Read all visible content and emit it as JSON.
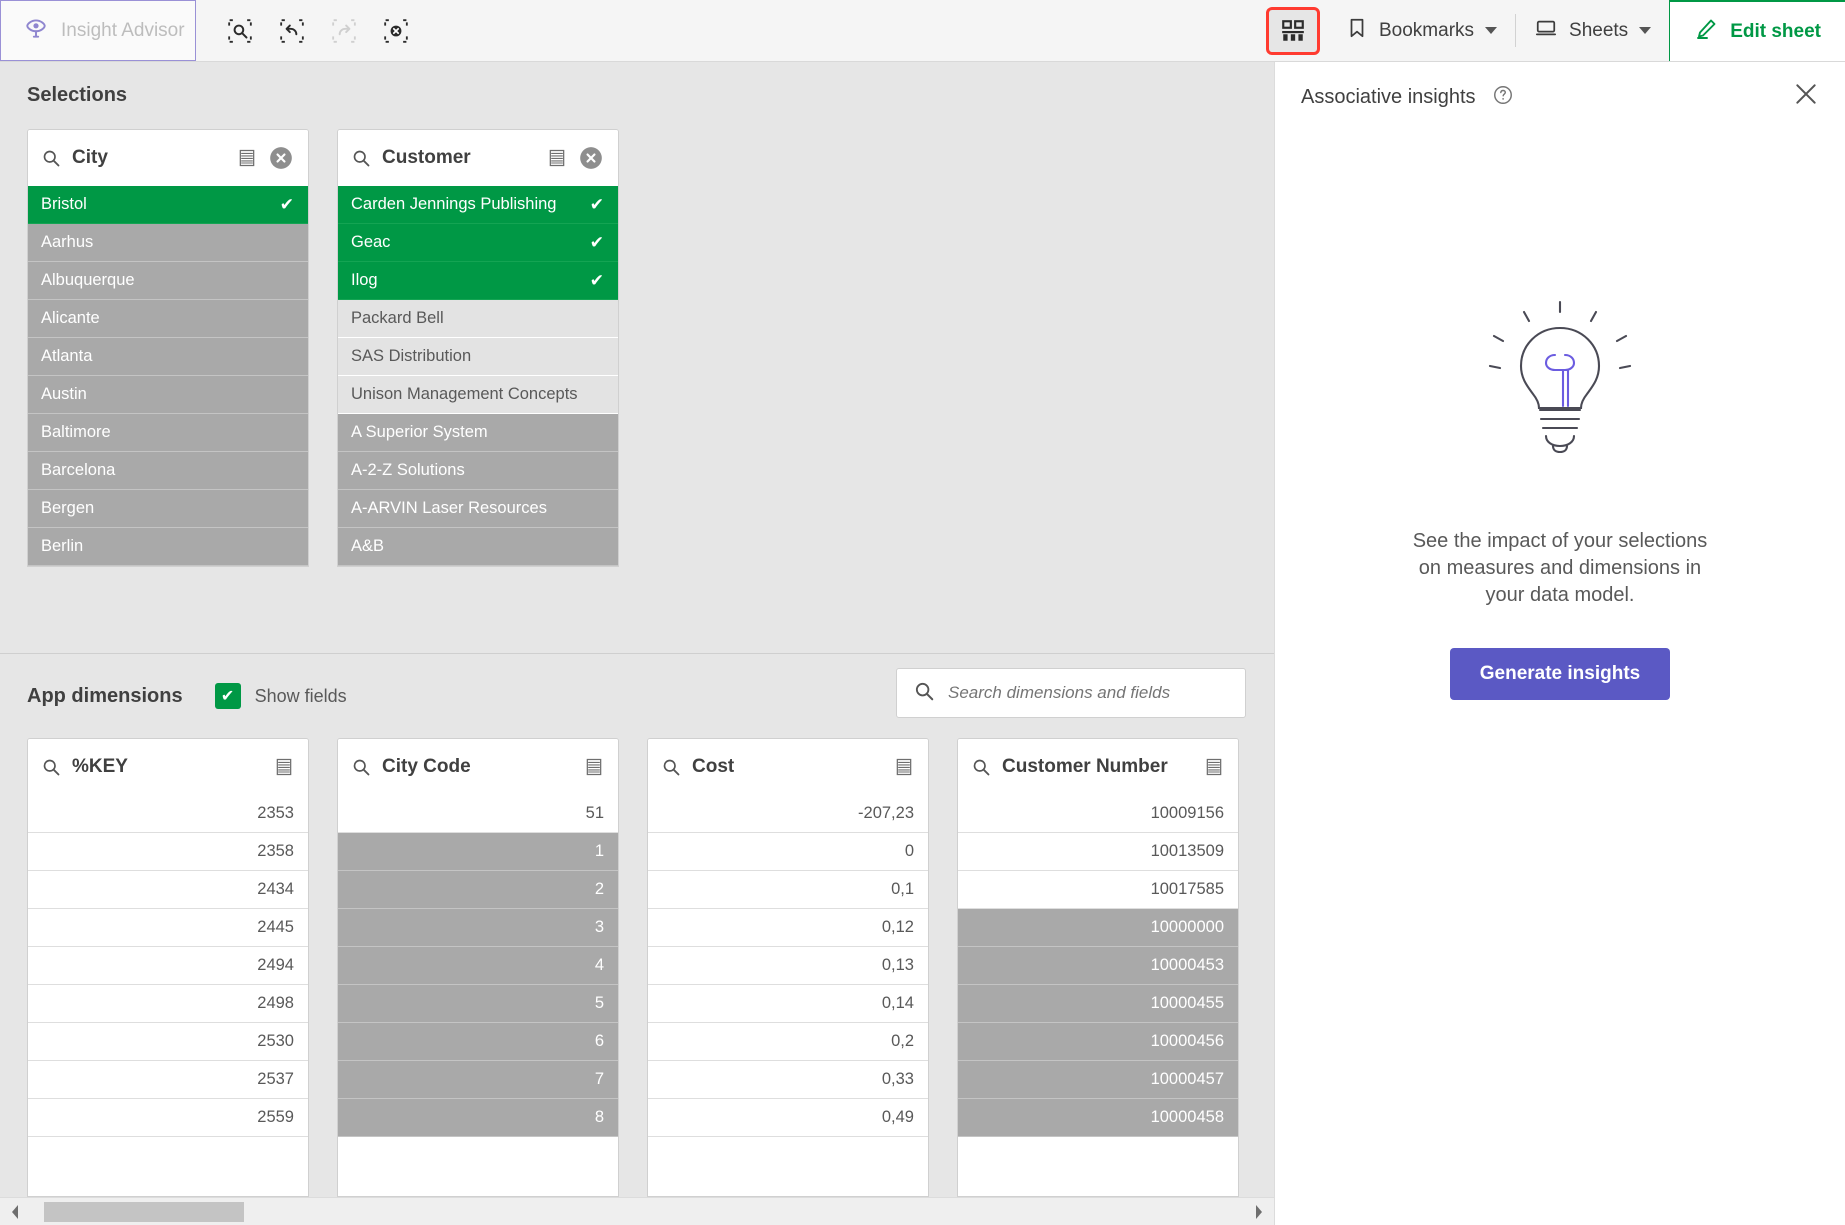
{
  "topbar": {
    "insight_advisor_label": "Insight Advisor",
    "tools": [
      {
        "name": "selection-search-icon",
        "title": "Search selections",
        "disabled": false
      },
      {
        "name": "step-back-icon",
        "title": "Step back",
        "disabled": false
      },
      {
        "name": "step-forward-icon",
        "title": "Step forward",
        "disabled": true
      },
      {
        "name": "clear-all-selections-icon",
        "title": "Clear all selections",
        "disabled": false
      }
    ],
    "associative_insights_toggle": "associative-insights-icon",
    "bookmarks_label": "Bookmarks",
    "sheets_label": "Sheets",
    "edit_sheet_label": "Edit sheet",
    "highlight_color": "#ff3b30",
    "accent_green": "#009845",
    "accent_purple": "#5b59c4"
  },
  "selections": {
    "title": "Selections",
    "listboxes": [
      {
        "field": "City",
        "has_clear": true,
        "numeric": false,
        "items": [
          {
            "value": "Bristol",
            "state": "selected"
          },
          {
            "value": "Aarhus",
            "state": "excluded"
          },
          {
            "value": "Albuquerque",
            "state": "excluded"
          },
          {
            "value": "Alicante",
            "state": "excluded"
          },
          {
            "value": "Atlanta",
            "state": "excluded"
          },
          {
            "value": "Austin",
            "state": "excluded"
          },
          {
            "value": "Baltimore",
            "state": "excluded"
          },
          {
            "value": "Barcelona",
            "state": "excluded"
          },
          {
            "value": "Bergen",
            "state": "excluded"
          },
          {
            "value": "Berlin",
            "state": "excluded"
          }
        ]
      },
      {
        "field": "Customer",
        "has_clear": true,
        "numeric": false,
        "items": [
          {
            "value": "Carden Jennings Publishing",
            "state": "selected"
          },
          {
            "value": "Geac",
            "state": "selected"
          },
          {
            "value": "Ilog",
            "state": "selected"
          },
          {
            "value": "Packard Bell",
            "state": "alternative"
          },
          {
            "value": "SAS Distribution",
            "state": "alternative"
          },
          {
            "value": "Unison Management Concepts",
            "state": "alternative"
          },
          {
            "value": "A Superior System",
            "state": "excluded"
          },
          {
            "value": "A-2-Z Solutions",
            "state": "excluded"
          },
          {
            "value": "A-ARVIN Laser Resources",
            "state": "excluded"
          },
          {
            "value": "A&B",
            "state": "excluded"
          }
        ]
      }
    ]
  },
  "dimensions": {
    "title": "App dimensions",
    "show_fields_label": "Show fields",
    "show_fields_checked": true,
    "search_placeholder": "Search dimensions and fields",
    "search_value": "",
    "listboxes": [
      {
        "field": "%KEY",
        "has_clear": false,
        "numeric": true,
        "items": [
          {
            "value": "2353",
            "state": "possible"
          },
          {
            "value": "2358",
            "state": "possible"
          },
          {
            "value": "2434",
            "state": "possible"
          },
          {
            "value": "2445",
            "state": "possible"
          },
          {
            "value": "2494",
            "state": "possible"
          },
          {
            "value": "2498",
            "state": "possible"
          },
          {
            "value": "2530",
            "state": "possible"
          },
          {
            "value": "2537",
            "state": "possible"
          },
          {
            "value": "2559",
            "state": "possible"
          }
        ]
      },
      {
        "field": "City Code",
        "has_clear": false,
        "numeric": true,
        "items": [
          {
            "value": "51",
            "state": "possible"
          },
          {
            "value": "1",
            "state": "excluded"
          },
          {
            "value": "2",
            "state": "excluded"
          },
          {
            "value": "3",
            "state": "excluded"
          },
          {
            "value": "4",
            "state": "excluded"
          },
          {
            "value": "5",
            "state": "excluded"
          },
          {
            "value": "6",
            "state": "excluded"
          },
          {
            "value": "7",
            "state": "excluded"
          },
          {
            "value": "8",
            "state": "excluded"
          }
        ]
      },
      {
        "field": "Cost",
        "has_clear": false,
        "numeric": true,
        "items": [
          {
            "value": "-207,23",
            "state": "possible"
          },
          {
            "value": "0",
            "state": "possible"
          },
          {
            "value": "0,1",
            "state": "possible"
          },
          {
            "value": "0,12",
            "state": "possible"
          },
          {
            "value": "0,13",
            "state": "possible"
          },
          {
            "value": "0,14",
            "state": "possible"
          },
          {
            "value": "0,2",
            "state": "possible"
          },
          {
            "value": "0,33",
            "state": "possible"
          },
          {
            "value": "0,49",
            "state": "possible"
          }
        ]
      },
      {
        "field": "Customer Number",
        "has_clear": false,
        "numeric": true,
        "items": [
          {
            "value": "10009156",
            "state": "possible"
          },
          {
            "value": "10013509",
            "state": "possible"
          },
          {
            "value": "10017585",
            "state": "possible"
          },
          {
            "value": "10000000",
            "state": "excluded"
          },
          {
            "value": "10000453",
            "state": "excluded"
          },
          {
            "value": "10000455",
            "state": "excluded"
          },
          {
            "value": "10000456",
            "state": "excluded"
          },
          {
            "value": "10000457",
            "state": "excluded"
          },
          {
            "value": "10000458",
            "state": "excluded"
          }
        ]
      }
    ]
  },
  "associative_insights": {
    "title": "Associative insights",
    "help_icon": "help-circle-icon",
    "close_icon": "close-icon",
    "illustration": "lightbulb-icon",
    "description": "See the impact of your selections on measures and dimensions in your data model.",
    "generate_button_label": "Generate insights"
  }
}
